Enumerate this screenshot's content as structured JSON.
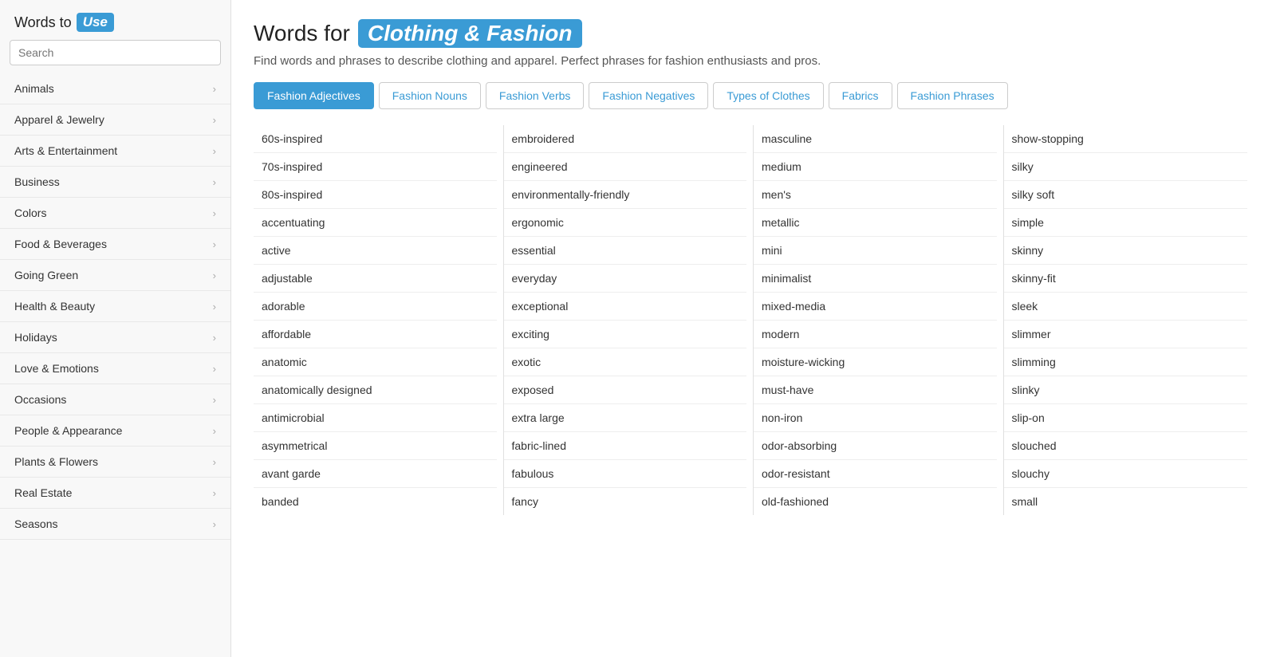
{
  "logo": {
    "words_label": "Words to",
    "use_label": "Use"
  },
  "search": {
    "placeholder": "Search"
  },
  "nav_items": [
    {
      "label": "Animals"
    },
    {
      "label": "Apparel & Jewelry"
    },
    {
      "label": "Arts & Entertainment"
    },
    {
      "label": "Business"
    },
    {
      "label": "Colors"
    },
    {
      "label": "Food & Beverages"
    },
    {
      "label": "Going Green"
    },
    {
      "label": "Health & Beauty"
    },
    {
      "label": "Holidays"
    },
    {
      "label": "Love & Emotions"
    },
    {
      "label": "Occasions"
    },
    {
      "label": "People & Appearance"
    },
    {
      "label": "Plants & Flowers"
    },
    {
      "label": "Real Estate"
    },
    {
      "label": "Seasons"
    }
  ],
  "page": {
    "title_prefix": "Words for",
    "title_highlight": "Clothing & Fashion",
    "subtitle": "Find words and phrases to describe clothing and apparel. Perfect phrases for fashion enthusiasts and pros."
  },
  "tabs": [
    {
      "label": "Fashion Adjectives",
      "active": true
    },
    {
      "label": "Fashion Nouns",
      "active": false
    },
    {
      "label": "Fashion Verbs",
      "active": false
    },
    {
      "label": "Fashion Negatives",
      "active": false
    },
    {
      "label": "Types of Clothes",
      "active": false
    },
    {
      "label": "Fabrics",
      "active": false
    },
    {
      "label": "Fashion Phrases",
      "active": false
    }
  ],
  "columns": [
    {
      "words": [
        "60s-inspired",
        "70s-inspired",
        "80s-inspired",
        "accentuating",
        "active",
        "adjustable",
        "adorable",
        "affordable",
        "anatomic",
        "anatomically designed",
        "antimicrobial",
        "asymmetrical",
        "avant garde",
        "banded"
      ]
    },
    {
      "words": [
        "embroidered",
        "engineered",
        "environmentally-friendly",
        "ergonomic",
        "essential",
        "everyday",
        "exceptional",
        "exciting",
        "exotic",
        "exposed",
        "extra large",
        "fabric-lined",
        "fabulous",
        "fancy"
      ]
    },
    {
      "words": [
        "masculine",
        "medium",
        "men's",
        "metallic",
        "mini",
        "minimalist",
        "mixed-media",
        "modern",
        "moisture-wicking",
        "must-have",
        "non-iron",
        "odor-absorbing",
        "odor-resistant",
        "old-fashioned"
      ]
    },
    {
      "words": [
        "show-stopping",
        "silky",
        "silky soft",
        "simple",
        "skinny",
        "skinny-fit",
        "sleek",
        "slimmer",
        "slimming",
        "slinky",
        "slip-on",
        "slouched",
        "slouchy",
        "small"
      ]
    }
  ]
}
